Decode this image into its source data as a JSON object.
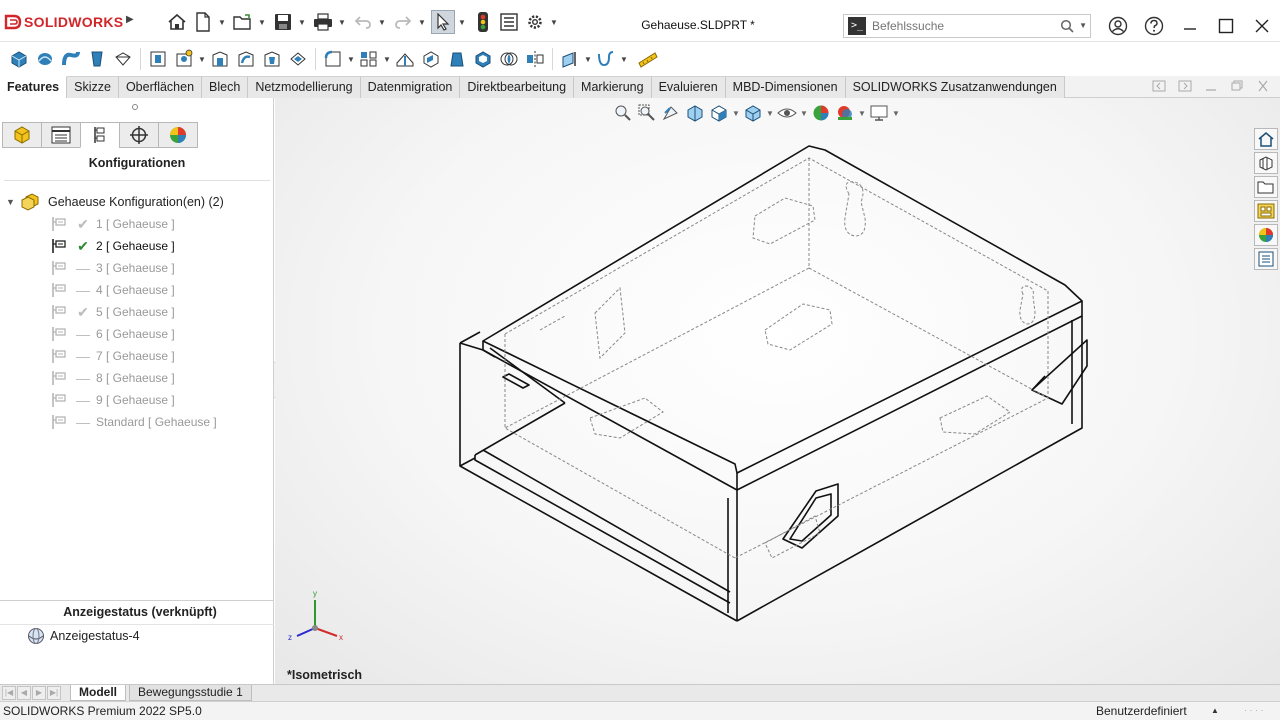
{
  "app": {
    "brand_ds": "3S",
    "brand_name": "SOLIDWORKS",
    "document_title": "Gehaeuse.SLDPRT *",
    "accent_color": "#d1262a"
  },
  "search": {
    "placeholder": "Befehlssuche"
  },
  "tabs": [
    "Features",
    "Skizze",
    "Oberflächen",
    "Blech",
    "Netzmodellierung",
    "Datenmigration",
    "Direktbearbeitung",
    "Markierung",
    "Evaluieren",
    "MBD-Dimensionen",
    "SOLIDWORKS Zusatzanwendungen"
  ],
  "active_tab": "Features",
  "left_panel": {
    "title": "Konfigurationen",
    "root_label": "Gehaeuse Konfiguration(en)  (2)",
    "configurations": [
      {
        "label": "1 [ Gehaeuse ]",
        "state": "checked-grey"
      },
      {
        "label": "2 [ Gehaeuse ]",
        "state": "active"
      },
      {
        "label": "3 [ Gehaeuse ]",
        "state": "dash"
      },
      {
        "label": "4 [ Gehaeuse ]",
        "state": "dash"
      },
      {
        "label": "5 [ Gehaeuse ]",
        "state": "checked-grey"
      },
      {
        "label": "6 [ Gehaeuse ]",
        "state": "dash"
      },
      {
        "label": "7 [ Gehaeuse ]",
        "state": "dash"
      },
      {
        "label": "8 [ Gehaeuse ]",
        "state": "dash"
      },
      {
        "label": "9 [ Gehaeuse ]",
        "state": "dash"
      },
      {
        "label": "Standard [ Gehaeuse ]",
        "state": "dash"
      }
    ],
    "display_state_title": "Anzeigestatus (verknüpft)",
    "display_state_item": "Anzeigestatus-4"
  },
  "viewport": {
    "view_label": "*Isometrisch",
    "triad": {
      "x": "x",
      "y": "y",
      "z": "z"
    }
  },
  "bottom_tabs": [
    "Modell",
    "Bewegungsstudie 1"
  ],
  "active_bottom_tab": "Modell",
  "status": {
    "left": "SOLIDWORKS Premium 2022 SP5.0",
    "right": "Benutzerdefiniert"
  }
}
